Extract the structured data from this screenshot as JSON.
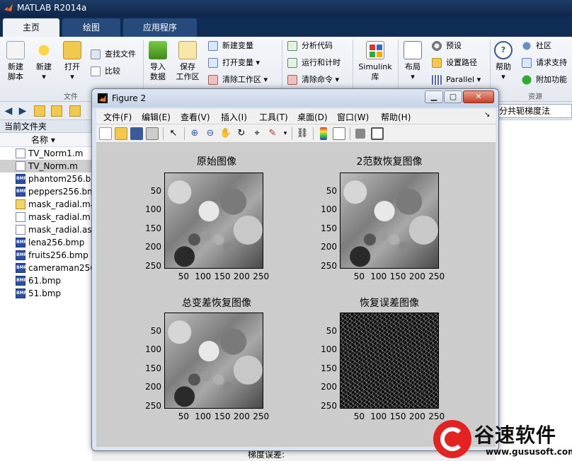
{
  "app": {
    "title": "MATLAB R2014a"
  },
  "ribbon_tabs": [
    "主页",
    "绘图",
    "应用程序"
  ],
  "ribbon": {
    "file": {
      "new_script": "新建\n脚本",
      "new": "新建",
      "open": "打开",
      "find_files": "查找文件",
      "compare": "比较",
      "group": "文件"
    },
    "variable": {
      "import": "导入\n数据",
      "save_workspace": "保存\n工作区",
      "new_variable": "新建变量",
      "open_variable": "打开变量",
      "clear_workspace": "清除工作区"
    },
    "code": {
      "analyze": "分析代码",
      "run_time": "运行和计时",
      "clear_commands": "清除命令"
    },
    "simulink": {
      "label": "Simulink\n库"
    },
    "environment": {
      "layout": "布局",
      "preferences": "预设",
      "set_path": "设置路径",
      "parallel": "Parallel"
    },
    "resources": {
      "help": "帮助",
      "community": "社区",
      "request_support": "请求支持",
      "addons": "附加功能",
      "group": "资源"
    }
  },
  "address": {
    "path_fragment": "分共轭梯度法"
  },
  "current_folder": {
    "header": "当前文件夹",
    "column_name": "名称",
    "files": [
      {
        "name": "TV_Norm1.m",
        "type": "m"
      },
      {
        "name": "TV_Norm.m",
        "type": "m",
        "selected": true
      },
      {
        "name": "phantom256.bm",
        "type": "bmp"
      },
      {
        "name": "peppers256.bm",
        "type": "bmp"
      },
      {
        "name": "mask_radial.ma",
        "type": "mat"
      },
      {
        "name": "mask_radial.m",
        "type": "m"
      },
      {
        "name": "mask_radial.asv",
        "type": "asv"
      },
      {
        "name": "lena256.bmp",
        "type": "bmp"
      },
      {
        "name": "fruits256.bmp",
        "type": "bmp"
      },
      {
        "name": "cameraman256",
        "type": "bmp"
      },
      {
        "name": "61.bmp",
        "type": "bmp"
      },
      {
        "name": "51.bmp",
        "type": "bmp"
      }
    ]
  },
  "figure": {
    "title": "Figure 2",
    "menu": [
      "文件(F)",
      "编辑(E)",
      "查看(V)",
      "插入(I)",
      "工具(T)",
      "桌面(D)",
      "窗口(W)",
      "帮助(H)"
    ],
    "plots": [
      {
        "title": "原始图像",
        "kind": "gray"
      },
      {
        "title": "2范数恢复图像",
        "kind": "gray"
      },
      {
        "title": "总变差恢复图像",
        "kind": "gray"
      },
      {
        "title": "恢复误差图像",
        "kind": "err"
      }
    ],
    "yticks": [
      "50",
      "100",
      "150",
      "200",
      "250"
    ],
    "xticks": [
      "50",
      "100",
      "150",
      "200",
      "250"
    ]
  },
  "bottom_text": "梯度误差:",
  "watermark": {
    "brand": "谷速软件",
    "url": "www.gususoft.com"
  },
  "colors": {
    "matlab_bar": "#0f2c55",
    "figure_bg": "#cccccc",
    "watermark_red": "#e32222"
  }
}
